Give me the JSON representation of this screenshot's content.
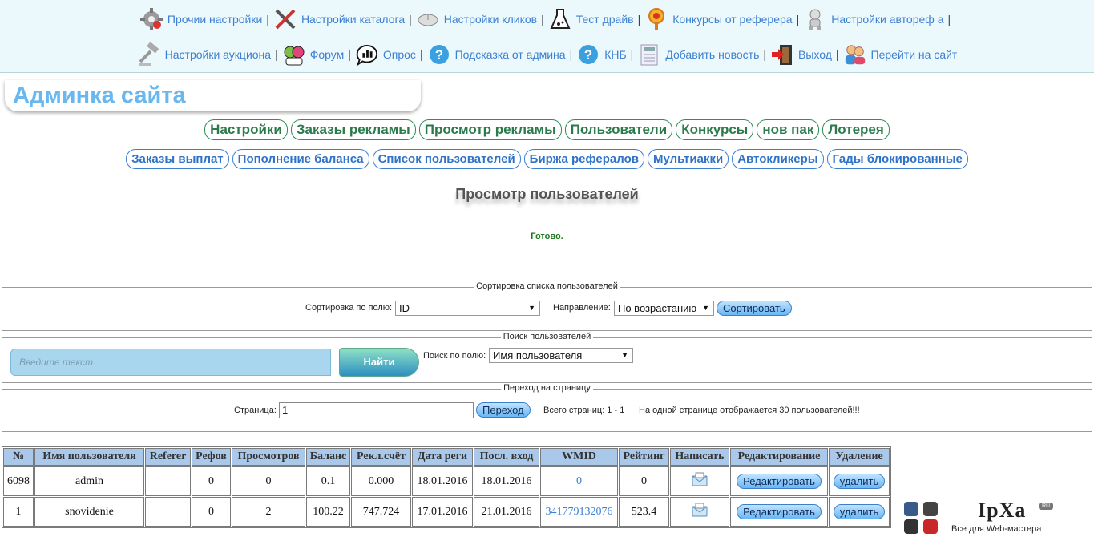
{
  "nav": {
    "row1": [
      {
        "label": "Прочии настройки",
        "icon": "gear-icon"
      },
      {
        "label": "Настройки каталога",
        "icon": "tools-icon"
      },
      {
        "label": "Настройки кликов",
        "icon": "mouse-icon"
      },
      {
        "label": "Тест драйв",
        "icon": "flask-icon"
      },
      {
        "label": "Конкурсы от реферера",
        "icon": "medal-icon"
      },
      {
        "label": "Настройки автореф а",
        "icon": "robot-icon"
      }
    ],
    "row2": [
      {
        "label": "Настройки аукциона",
        "icon": "gavel-icon"
      },
      {
        "label": "Форум",
        "icon": "forum-icon"
      },
      {
        "label": "Опрос",
        "icon": "poll-icon"
      },
      {
        "label": "Подсказка от админа",
        "icon": "help-icon"
      },
      {
        "label": "КНБ",
        "icon": "help-icon"
      },
      {
        "label": "Добавить новость",
        "icon": "news-icon"
      },
      {
        "label": "Выход",
        "icon": "exit-icon"
      },
      {
        "label": "Перейти на сайт",
        "icon": "people-icon"
      }
    ],
    "separator": "|"
  },
  "site_title": "Админка сайта",
  "menu1": [
    "Настройки",
    "Заказы рекламы",
    "Просмотр рекламы",
    "Пользователи",
    "Конкурсы",
    "нов пак",
    "Лотерея"
  ],
  "menu2": [
    "Заказы выплат",
    "Пополнение баланса",
    "Список пользователей",
    "Биржа рефералов",
    "Мультиакки",
    "Автокликеры",
    "Гады блокированные"
  ],
  "page_heading": "Просмотр пользователей",
  "status_message": "Готово.",
  "sort": {
    "legend": "Сортировка списка пользователей",
    "field_label": "Сортировка по полю:",
    "field_value": "ID",
    "direction_label": "Направление:",
    "direction_value": "По возрастанию",
    "button": "Сортировать"
  },
  "search": {
    "legend": "Поиск пользователей",
    "placeholder": "Введите текст",
    "button": "Найти",
    "field_label": "Поиск по полю:",
    "field_value": "Имя пользователя"
  },
  "pager": {
    "legend": "Переход на страницу",
    "page_label": "Страница:",
    "page_value": "1",
    "button": "Переход",
    "total_pages": "Всего страниц:   1 - 1",
    "per_page_note": "На одной странице отображается 30 пользователей!!!"
  },
  "table": {
    "headers": [
      "№",
      "Имя пользователя",
      "Referer",
      "Рефов",
      "Просмотров",
      "Баланс",
      "Рекл.счёт",
      "Дата реги",
      "Посл. вход",
      "WMID",
      "Рейтинг",
      "Написать",
      "Редактирование",
      "Удаление"
    ],
    "rows": [
      {
        "id": "6098",
        "name": "admin",
        "referer": "",
        "refs": "0",
        "views": "0",
        "balance": "0.1",
        "ad_account": "0.000",
        "reg_date": "18.01.2016",
        "last_login": "18.01.2016",
        "wmid": "0",
        "rating": "0"
      },
      {
        "id": "1",
        "name": "snovidenie",
        "referer": "",
        "refs": "0",
        "views": "2",
        "balance": "100.22",
        "ad_account": "747.724",
        "reg_date": "17.01.2016",
        "last_login": "21.01.2016",
        "wmid": "341779132076",
        "rating": "523.4"
      }
    ],
    "edit_label": "Редактировать",
    "delete_label": "удалить",
    "write_icon": "envelope-icon"
  },
  "logo": {
    "title": "IpXa",
    "badge": "RU",
    "subtitle": "Все для Web-мастера"
  }
}
